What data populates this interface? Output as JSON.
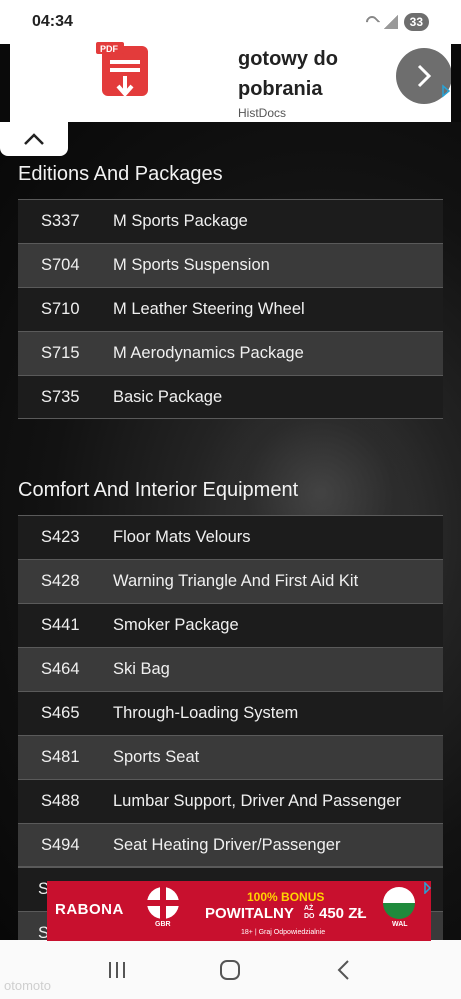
{
  "status_bar": {
    "time": "04:34",
    "battery": "33"
  },
  "ad_top": {
    "title": "gotowy do pobrania",
    "source": "HistDocs",
    "pdf_label": "PDF"
  },
  "sections": [
    {
      "title": "Editions And Packages",
      "rows": [
        {
          "code": "S337",
          "name": "M Sports Package"
        },
        {
          "code": "S704",
          "name": "M Sports Suspension"
        },
        {
          "code": "S710",
          "name": "M Leather Steering Wheel"
        },
        {
          "code": "S715",
          "name": "M Aerodynamics Package"
        },
        {
          "code": "S735",
          "name": "Basic Package"
        }
      ]
    },
    {
      "title": "Comfort And Interior Equipment",
      "rows": [
        {
          "code": "S423",
          "name": "Floor Mats Velours"
        },
        {
          "code": "S428",
          "name": "Warning Triangle And First Aid Kit"
        },
        {
          "code": "S441",
          "name": "Smoker Package"
        },
        {
          "code": "S464",
          "name": "Ski Bag"
        },
        {
          "code": "S465",
          "name": "Through-Loading System"
        },
        {
          "code": "S481",
          "name": "Sports Seat"
        },
        {
          "code": "S488",
          "name": "Lumbar Support, Driver And Passenger"
        },
        {
          "code": "S494",
          "name": "Seat Heating Driver/Passenger"
        }
      ],
      "partial_rows": [
        "S",
        "S"
      ]
    }
  ],
  "ad_bottom": {
    "brand": "RABONA",
    "bonus": "100% BONUS",
    "welcome": "POWITALNY",
    "upto_line1": "AŻ",
    "upto_line2": "DO",
    "amount": "450 ZŁ",
    "legal": "18+ | Graj Odpowiedzialnie",
    "flag_left": "GBR",
    "flag_right": "WAL"
  },
  "watermark": "otomoto"
}
